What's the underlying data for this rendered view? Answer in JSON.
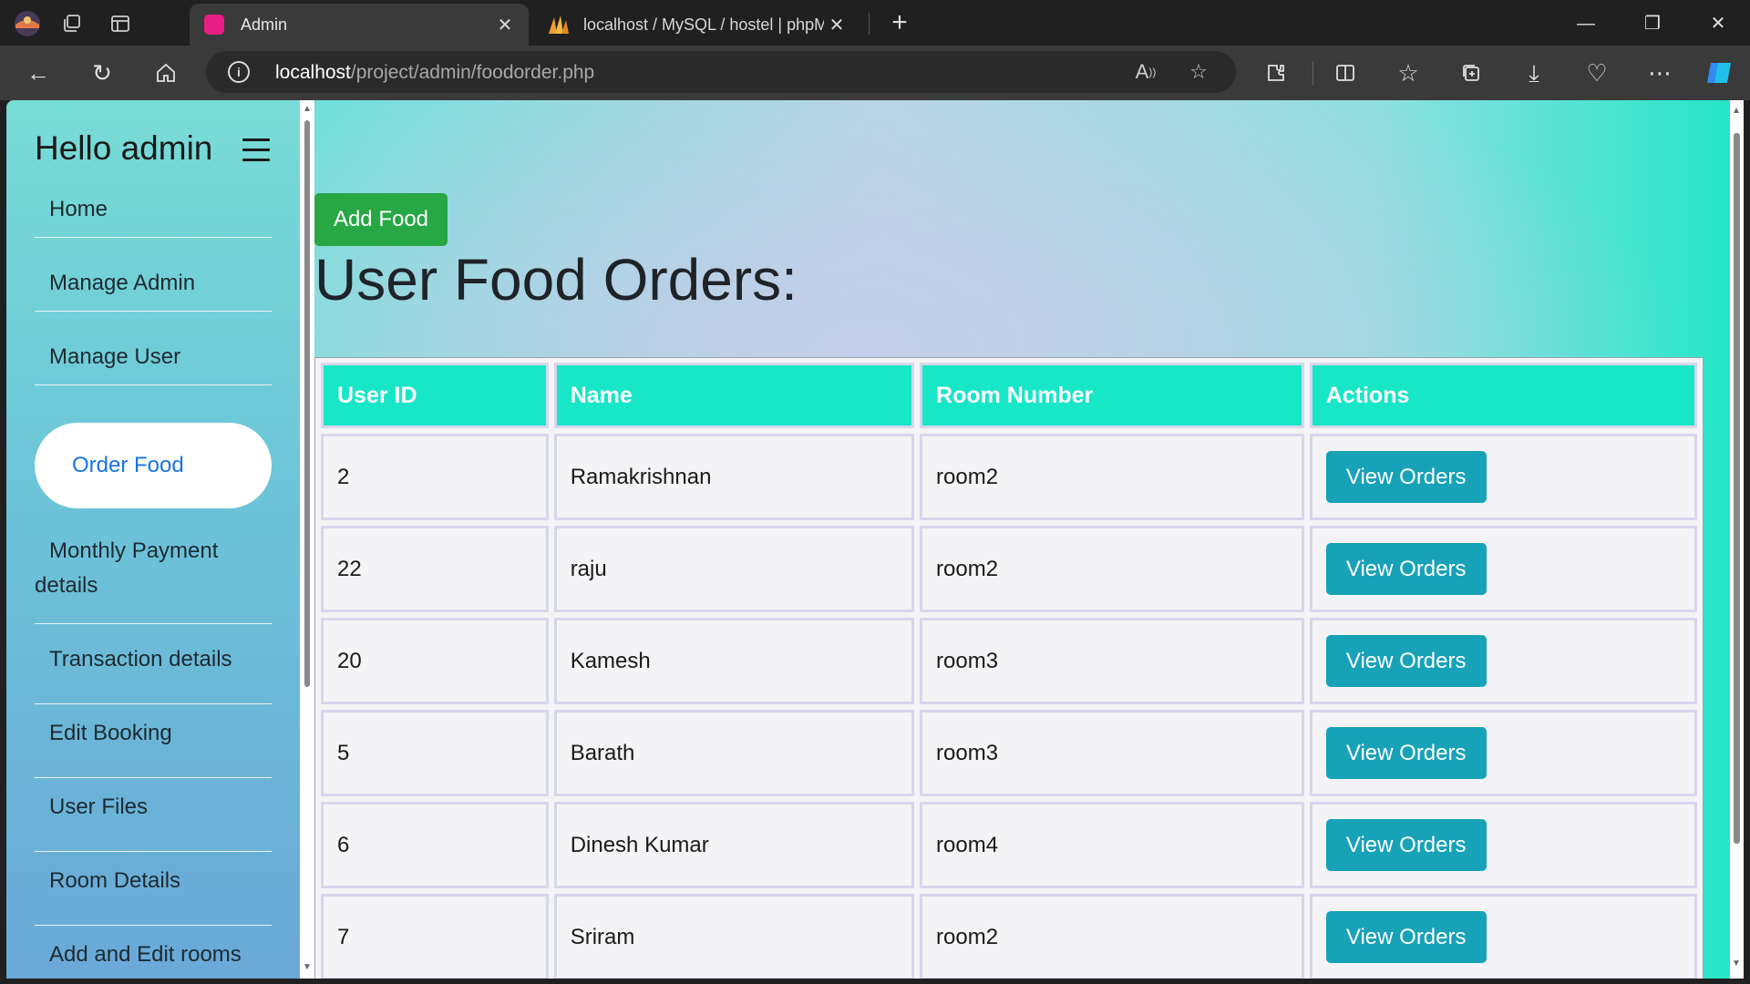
{
  "browser": {
    "tabs": [
      {
        "title": "Admin",
        "active": true
      },
      {
        "title": "localhost / MySQL / hostel | phpMyAdmin",
        "active": false
      }
    ],
    "url": {
      "host": "localhost",
      "path": "/project/admin/foodorder.php"
    }
  },
  "sidebar": {
    "greeting": "Hello admin",
    "items": [
      {
        "label": "Home"
      },
      {
        "label": "Manage Admin"
      },
      {
        "label": "Manage User"
      },
      {
        "label": "Order Food",
        "active": true
      },
      {
        "label": "Monthly Payment details"
      },
      {
        "label": "Transaction details"
      },
      {
        "label": "Edit Booking"
      },
      {
        "label": "User Files"
      },
      {
        "label": "Room Details"
      },
      {
        "label": "Add and Edit rooms"
      }
    ]
  },
  "main": {
    "add_food_label": "Add Food",
    "heading": "User Food Orders:",
    "table": {
      "headers": [
        "User ID",
        "Name",
        "Room Number",
        "Actions"
      ],
      "action_label": "View Orders",
      "rows": [
        {
          "id": "2",
          "name": "Ramakrishnan",
          "room": "room2"
        },
        {
          "id": "22",
          "name": "raju",
          "room": "room2"
        },
        {
          "id": "20",
          "name": "Kamesh",
          "room": "room3"
        },
        {
          "id": "5",
          "name": "Barath",
          "room": "room3"
        },
        {
          "id": "6",
          "name": "Dinesh Kumar",
          "room": "room4"
        },
        {
          "id": "7",
          "name": "Sriram",
          "room": "room2"
        }
      ]
    }
  },
  "colors": {
    "header_cell": "#17e6c7",
    "add_food_button": "#28a745",
    "view_orders_button": "#17a2b8",
    "active_nav_text": "#1a73e8"
  }
}
